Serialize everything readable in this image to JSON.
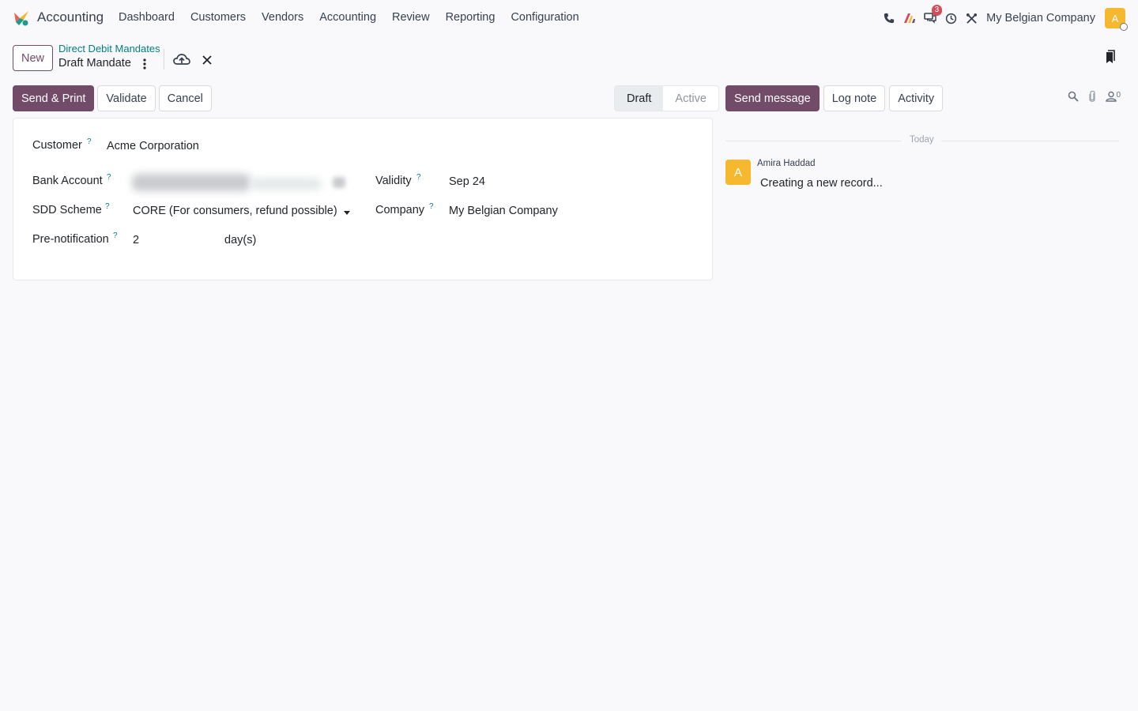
{
  "navbar": {
    "app_name": "Accounting",
    "menu": [
      "Dashboard",
      "Customers",
      "Vendors",
      "Accounting",
      "Review",
      "Reporting",
      "Configuration"
    ],
    "messages_badge": "3",
    "company": "My Belgian Company",
    "avatar_initial": "A"
  },
  "control_panel": {
    "new_label": "New",
    "breadcrumb_parent": "Direct Debit Mandates",
    "breadcrumb_current": "Draft Mandate"
  },
  "actions": {
    "send_print": "Send & Print",
    "validate": "Validate",
    "cancel": "Cancel"
  },
  "status": {
    "items": [
      "Draft",
      "Active"
    ],
    "current": "Draft"
  },
  "form": {
    "customer_label": "Customer",
    "customer_value": "Acme Corporation",
    "bank_account_label": "Bank Account",
    "sdd_scheme_label": "SDD Scheme",
    "sdd_scheme_value": "CORE (For consumers, refund possible)",
    "prenotification_label": "Pre-notification",
    "prenotification_value": "2",
    "prenotification_unit": "day(s)",
    "validity_label": "Validity",
    "validity_value": "Sep 24",
    "company_label": "Company",
    "company_value": "My Belgian Company",
    "help_mark": "?"
  },
  "chatter": {
    "send_message": "Send message",
    "log_note": "Log note",
    "activity": "Activity",
    "followers_count": "0",
    "date_separator": "Today",
    "message": {
      "avatar_initial": "A",
      "author": "Amira Haddad",
      "body": "Creating a new record..."
    }
  },
  "colors": {
    "primary": "#714b67",
    "link": "#017e84",
    "avatar": "#f5b82e",
    "badge": "#d44c59"
  }
}
